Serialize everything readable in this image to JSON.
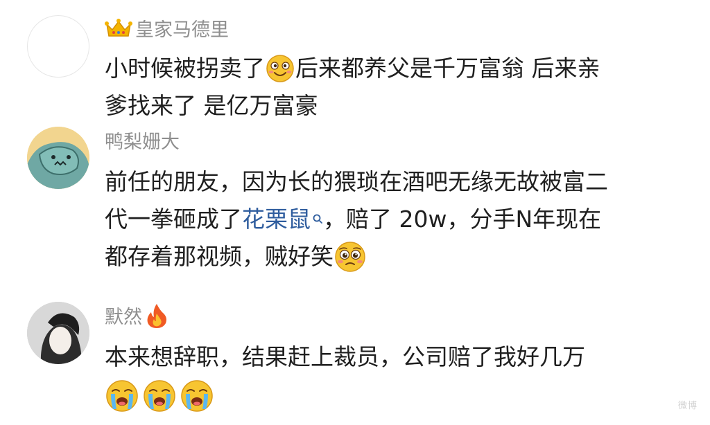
{
  "comments": [
    {
      "username": "皇家马德里",
      "badge": "crown-icon",
      "lines": [
        "小时候被拐卖了",
        "后来都养父是千万富翁 后来亲",
        "爹找来了 是亿万富豪"
      ],
      "emoji": "smile-emoji-icon"
    },
    {
      "username": "鸭梨姗大",
      "lines": [
        "前任的朋友，因为长的猥琐在酒吧无缘无故被富二",
        "代一拳砸成了",
        "，赔了 20w，分手N年现在",
        "都存着那视频，贼好笑"
      ],
      "link": "花栗鼠",
      "emoji": "pleading-emoji-icon"
    },
    {
      "username": "默然",
      "badge": "fire-icon",
      "lines": [
        "本来想辞职，结果赶上裁员，公司赔了我好几万"
      ],
      "emoji": "crying-emoji-icon"
    }
  ],
  "watermark": "微博",
  "colors": {
    "username": "#8f8f8f",
    "text": "#1f1f1f",
    "link": "#2f5d9e",
    "emoji": "#f7c531"
  }
}
